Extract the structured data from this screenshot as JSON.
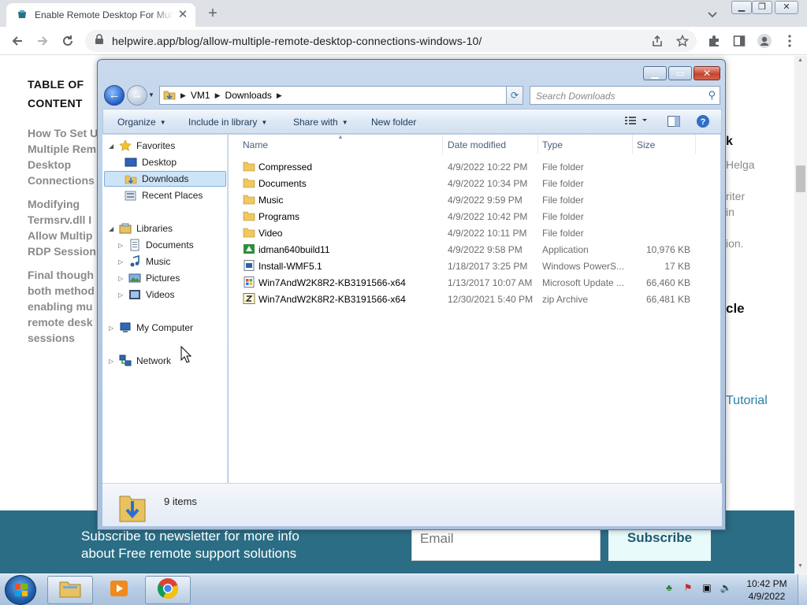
{
  "browser": {
    "tab_title": "Enable Remote Desktop For Multiple",
    "url": "helpwire.app/blog/allow-multiple-remote-desktop-connections-windows-10/",
    "window_buttons": [
      "minimize",
      "restore",
      "close"
    ]
  },
  "webpage": {
    "toc_title_line1": "TABLE OF",
    "toc_title_line2": "CONTENT",
    "toc_items": [
      [
        "How To Set U",
        "Multiple Rem",
        "Desktop",
        "Connections"
      ],
      [
        "Modifying",
        "Termsrv.dll I",
        "Allow Multip",
        "RDP Session"
      ],
      [
        "Final though",
        "both method",
        "enabling mu",
        "remote desk",
        "sessions"
      ]
    ],
    "right_fragments": {
      "r1": "k",
      "r2": "Helga",
      "r3": "riter",
      "r4": "in",
      "r5": "ion.",
      "r6": "cle",
      "r7": "Tutorial"
    },
    "newsletter_line1": "Subscribe to newsletter for more info",
    "newsletter_line2": "about Free remote support solutions",
    "email_placeholder": "Email",
    "subscribe_label": "Subscribe"
  },
  "explorer": {
    "breadcrumb": [
      "VM1",
      "Downloads"
    ],
    "search_placeholder": "Search Downloads",
    "commands": {
      "organize": "Organize",
      "include": "Include in library",
      "share": "Share with",
      "new_folder": "New folder"
    },
    "nav": {
      "favorites": "Favorites",
      "desktop": "Desktop",
      "downloads": "Downloads",
      "recent": "Recent Places",
      "libraries": "Libraries",
      "documents": "Documents",
      "music": "Music",
      "pictures": "Pictures",
      "videos": "Videos",
      "computer": "My Computer",
      "network": "Network"
    },
    "columns": {
      "name": "Name",
      "date": "Date modified",
      "type": "Type",
      "size": "Size"
    },
    "files": [
      {
        "name": "Compressed",
        "date": "4/9/2022 10:22 PM",
        "type": "File folder",
        "size": "",
        "icon": "folder-icon"
      },
      {
        "name": "Documents",
        "date": "4/9/2022 10:34 PM",
        "type": "File folder",
        "size": "",
        "icon": "folder-icon"
      },
      {
        "name": "Music",
        "date": "4/9/2022 9:59 PM",
        "type": "File folder",
        "size": "",
        "icon": "folder-icon"
      },
      {
        "name": "Programs",
        "date": "4/9/2022 10:42 PM",
        "type": "File folder",
        "size": "",
        "icon": "folder-icon"
      },
      {
        "name": "Video",
        "date": "4/9/2022 10:11 PM",
        "type": "File folder",
        "size": "",
        "icon": "folder-icon"
      },
      {
        "name": "idman640build11",
        "date": "4/9/2022 9:58 PM",
        "type": "Application",
        "size": "10,976 KB",
        "icon": "app-icon"
      },
      {
        "name": "Install-WMF5.1",
        "date": "1/18/2017 3:25 PM",
        "type": "Windows PowerS...",
        "size": "17 KB",
        "icon": "script-icon"
      },
      {
        "name": "Win7AndW2K8R2-KB3191566-x64",
        "date": "1/13/2017 10:07 AM",
        "type": "Microsoft Update ...",
        "size": "66,460 KB",
        "icon": "update-icon"
      },
      {
        "name": "Win7AndW2K8R2-KB3191566-x64",
        "date": "12/30/2021 5:40 PM",
        "type": "zip Archive",
        "size": "66,481 KB",
        "icon": "zip-icon"
      }
    ],
    "item_count": "9 items"
  },
  "taskbar": {
    "time": "10:42 PM",
    "date": "4/9/2022"
  }
}
